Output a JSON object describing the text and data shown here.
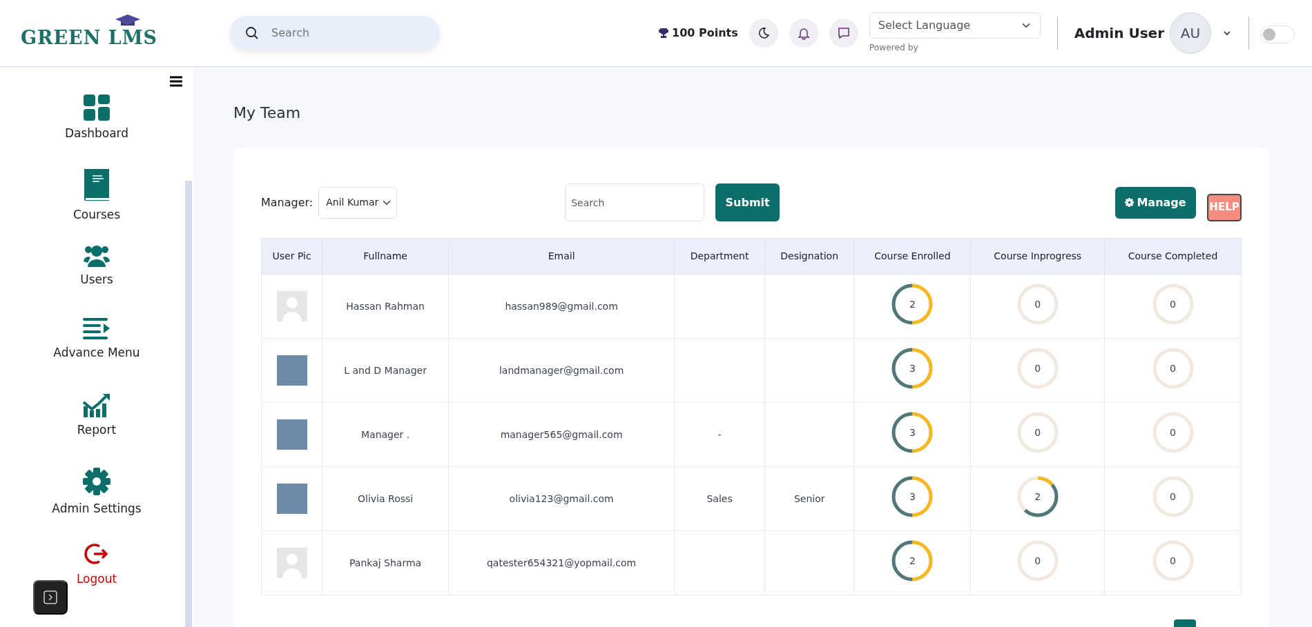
{
  "header": {
    "logo": "GREEN LMS",
    "search": {
      "placeholder": "Search"
    },
    "points": "100 Points",
    "language": {
      "value": "Select Language",
      "note": "Powered by"
    },
    "user": {
      "name": "Admin User",
      "initials": "AU"
    },
    "theme_switch": {
      "on": false
    }
  },
  "sidebar": {
    "items": [
      {
        "label": "Dashboard",
        "kind": "dashboard"
      },
      {
        "label": "Courses",
        "kind": "courses"
      },
      {
        "label": "Users",
        "kind": "users"
      },
      {
        "label": "Advance Menu",
        "kind": "menu"
      },
      {
        "label": "Report",
        "kind": "report"
      },
      {
        "label": "Admin Settings",
        "kind": "settings"
      },
      {
        "label": "Logout",
        "kind": "logout"
      }
    ]
  },
  "page": {
    "title": "My Team"
  },
  "filters": {
    "manager_label": "Manager:",
    "manager": "Anil Kumar",
    "search": {
      "placeholder": "Search"
    },
    "submit": "Submit",
    "manage": "Manage",
    "help": "HELP"
  },
  "table": {
    "columns": [
      "User Pic",
      "Fullname",
      "Email",
      "Department",
      "Designation",
      "Course Enrolled",
      "Course Inprogress",
      "Course Completed"
    ],
    "rows": [
      {
        "pic": {
          "kind": "silhouette"
        },
        "fullname": "Hassan Rahman",
        "email": "hassan989@gmail.com",
        "department": "",
        "designation": "",
        "enrolled": {
          "value": "2",
          "kind": "full"
        },
        "inprogress": {
          "value": "0",
          "kind": "empty"
        },
        "completed": {
          "value": "0",
          "kind": "empty"
        }
      },
      {
        "pic": {
          "kind": "photo"
        },
        "fullname": "L and D Manager",
        "email": "landmanager@gmail.com",
        "department": "",
        "designation": "",
        "enrolled": {
          "value": "3",
          "kind": "full"
        },
        "inprogress": {
          "value": "0",
          "kind": "empty"
        },
        "completed": {
          "value": "0",
          "kind": "empty"
        }
      },
      {
        "pic": {
          "kind": "photo"
        },
        "fullname": "Manager .",
        "email": "manager565@gmail.com",
        "department": "-",
        "designation": "",
        "enrolled": {
          "value": "3",
          "kind": "full"
        },
        "inprogress": {
          "value": "0",
          "kind": "empty"
        },
        "completed": {
          "value": "0",
          "kind": "empty"
        }
      },
      {
        "pic": {
          "kind": "photo"
        },
        "fullname": "Olivia Rossi",
        "email": "olivia123@gmail.com",
        "department": "Sales",
        "designation": "Senior",
        "enrolled": {
          "value": "3",
          "kind": "full"
        },
        "inprogress": {
          "value": "2",
          "kind": "partial"
        },
        "completed": {
          "value": "0",
          "kind": "empty"
        }
      },
      {
        "pic": {
          "kind": "silhouette"
        },
        "fullname": "Pankaj Sharma",
        "email": "qatester654321@yopmail.com",
        "department": "",
        "designation": "",
        "enrolled": {
          "value": "2",
          "kind": "full"
        },
        "inprogress": {
          "value": "0",
          "kind": "empty"
        },
        "completed": {
          "value": "0",
          "kind": "empty"
        }
      }
    ]
  }
}
